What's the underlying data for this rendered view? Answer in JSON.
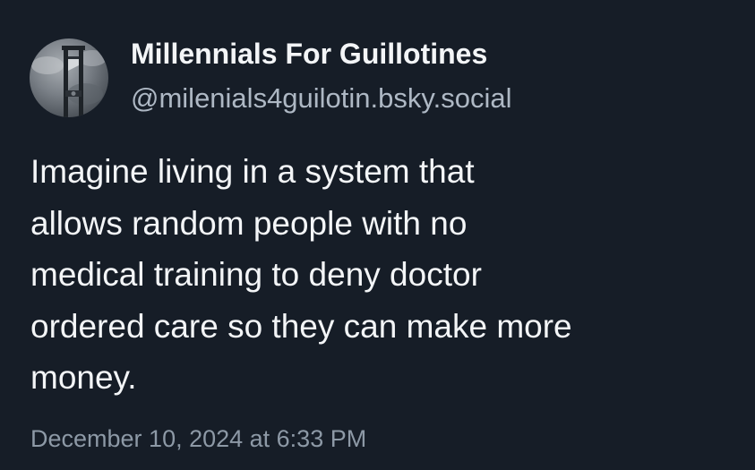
{
  "profile": {
    "display_name": "Millennials For Guillotines",
    "handle": "@milenials4guilotin.bsky.social",
    "avatar_icon": "guillotine-avatar-icon"
  },
  "post": {
    "text_lines": [
      "Imagine living in a system that",
      "allows random people with no",
      "medical training to deny doctor",
      "ordered care so they can make more",
      "money."
    ],
    "timestamp": "December 10, 2024 at 6:33 PM"
  },
  "colors": {
    "background": "#161d27",
    "primary_text": "#f3f5f7",
    "handle_text": "#aeb8c4",
    "timestamp_text": "#8d99a6"
  }
}
